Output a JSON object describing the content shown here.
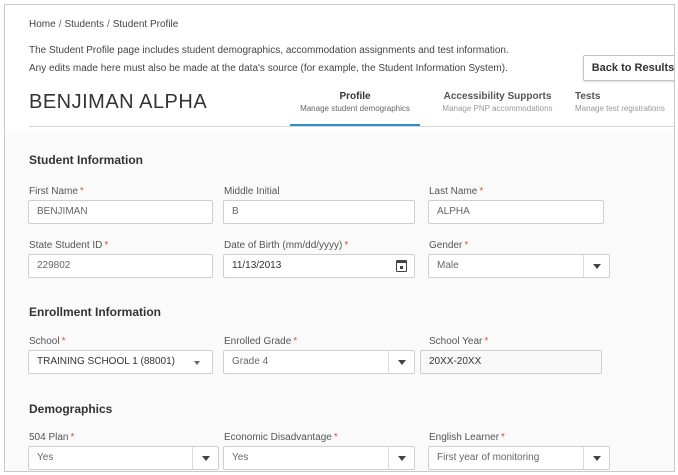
{
  "breadcrumb": {
    "home": "Home",
    "students": "Students",
    "current": "Student Profile",
    "separator": "/"
  },
  "description": {
    "line1": "The Student Profile page includes student demographics, accommodation assignments and test information.",
    "line2": "Any edits made here must also be made at the data's source (for example, the Student Information System)."
  },
  "back_button": "Back to Results",
  "student_name": "BENJIMAN ALPHA",
  "tabs": [
    {
      "title": "Profile",
      "subtitle": "Manage student demographics",
      "active": true
    },
    {
      "title": "Accessibility Supports",
      "subtitle": "Manage PNP accommodations",
      "active": false
    },
    {
      "title": "Tests",
      "subtitle": "Manage test registrations",
      "active": false
    }
  ],
  "required_marker": "*",
  "student_info": {
    "title": "Student Information",
    "first_name": {
      "label": "First Name",
      "value": "BENJIMAN",
      "required": true
    },
    "middle_initial": {
      "label": "Middle Initial",
      "value": "B",
      "required": false
    },
    "last_name": {
      "label": "Last Name",
      "value": "ALPHA",
      "required": true
    },
    "state_student_id": {
      "label": "State Student ID",
      "value": "229802",
      "required": true
    },
    "date_of_birth": {
      "label": "Date of Birth (mm/dd/yyyy)",
      "value": "11/13/2013",
      "required": true
    },
    "gender": {
      "label": "Gender",
      "value": "Male",
      "required": true
    }
  },
  "enrollment_info": {
    "title": "Enrollment Information",
    "school": {
      "label": "School",
      "value": "TRAINING SCHOOL 1 (88001)",
      "required": true
    },
    "enrolled_grade": {
      "label": "Enrolled Grade",
      "value": "Grade 4",
      "required": true
    },
    "school_year": {
      "label": "School Year",
      "value": "20XX-20XX",
      "required": true
    }
  },
  "demographics": {
    "title": "Demographics",
    "plan_504": {
      "label": "504 Plan",
      "value": "Yes",
      "required": true
    },
    "economic_disadvantage": {
      "label": "Economic Disadvantage",
      "value": "Yes",
      "required": true
    },
    "english_learner": {
      "label": "English Learner",
      "value": "First year of monitoring",
      "required": true
    }
  },
  "colors": {
    "accent": "#2c8fc9",
    "required": "#e0514b",
    "border": "#cfcfcf"
  }
}
